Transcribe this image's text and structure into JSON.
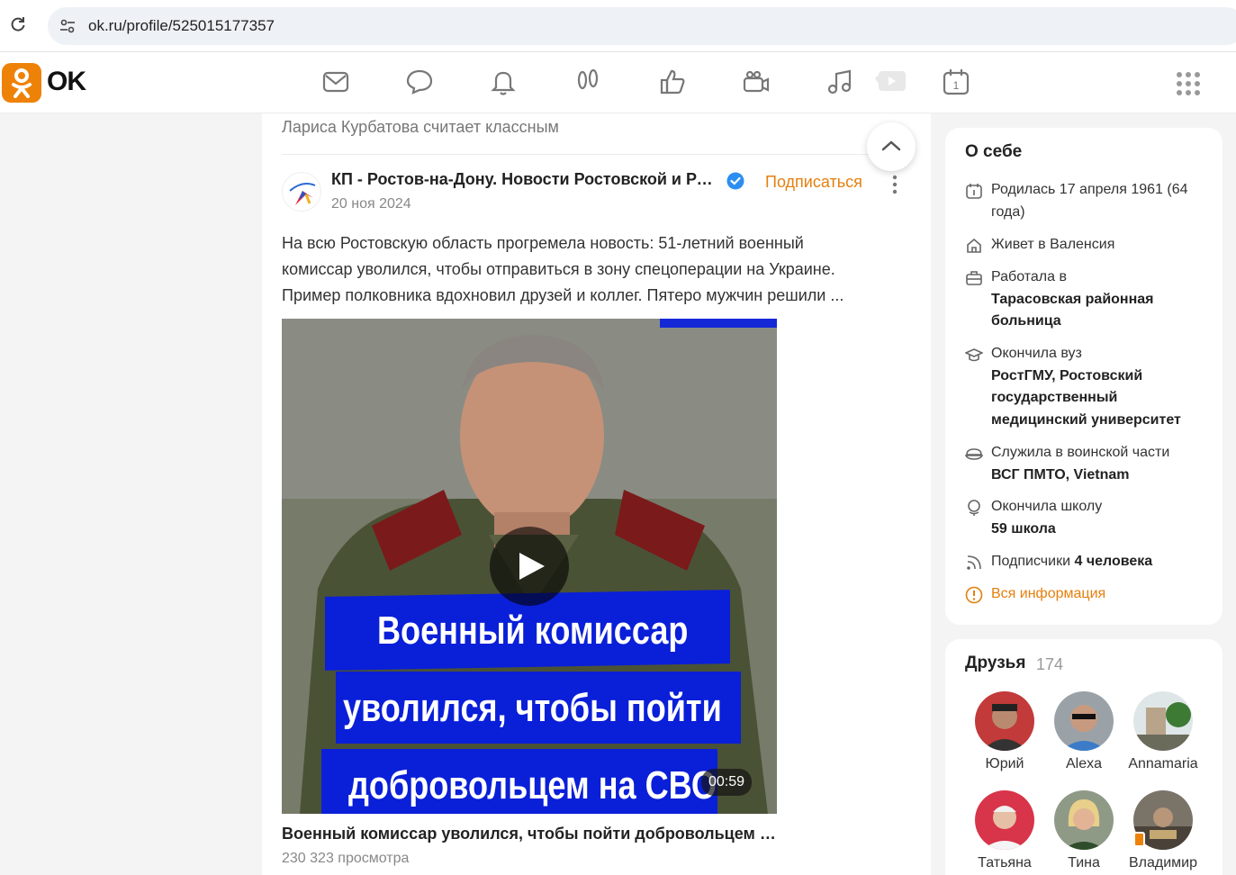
{
  "browser": {
    "url": "ok.ru/profile/525015177357"
  },
  "header": {
    "logo_text": "OK",
    "nav_icons": [
      "mail-icon",
      "discussions-icon",
      "notifications-icon",
      "guests-icon",
      "likes-icon",
      "friends-icon",
      "music-icon",
      "video-icon",
      "calendar-icon"
    ],
    "calendar_day": "1"
  },
  "feed": {
    "liked_by": "Лариса Курбатова считает классным",
    "post": {
      "group_name": "КП - Ростов-на-Дону. Новости Ростовской и Ростова",
      "date": "20 ноя 2024",
      "subscribe_label": "Подписаться",
      "text_lines": [
        "На всю Ростовскую область прогремела новость: 51-летний военный",
        "комиссар уволился, чтобы отправиться в зону спецоперации на Украине.",
        "Пример полковника вдохновил друзей и коллег. Пятеро мужчин решили ..."
      ],
      "video": {
        "caption_lines": [
          "Военный комиссар",
          "уволился, чтобы пойти",
          "добровольцем на СВО"
        ],
        "duration": "00:59",
        "title": "Военный комиссар уволился, чтобы пойти добровольцем на СВО",
        "views": "230 323 просмотра"
      }
    }
  },
  "about": {
    "title": "О себе",
    "born": "Родилась 17 апреля 1961 (64 года)",
    "lives": "Живет в Валенсия",
    "work_label": "Работала в",
    "work_place": "Тарасовская районная больница",
    "uni_label": "Окончила вуз",
    "uni_name": "РостГМУ, Ростовский государственный медицинский университет",
    "army_label": "Служила в воинской части",
    "army_unit": "ВСГ ПМТО, Vietnam",
    "school_label": "Окончила школу",
    "school_name": "59 школа",
    "subs_label": "Подписчики",
    "subs_count": "4 человека",
    "all_info": "Вся информация"
  },
  "friends": {
    "title": "Друзья",
    "count": "174",
    "items": [
      {
        "name": "Юрий"
      },
      {
        "name": "Alexa"
      },
      {
        "name": "Annamaria"
      },
      {
        "name": "Татьяна"
      },
      {
        "name": "Тина"
      },
      {
        "name": "Владимир"
      }
    ]
  },
  "colors": {
    "accent": "#ee8208",
    "link": "#e57f0e",
    "verified": "#2c8ef0",
    "caption_bg": "#0a1fd8"
  }
}
